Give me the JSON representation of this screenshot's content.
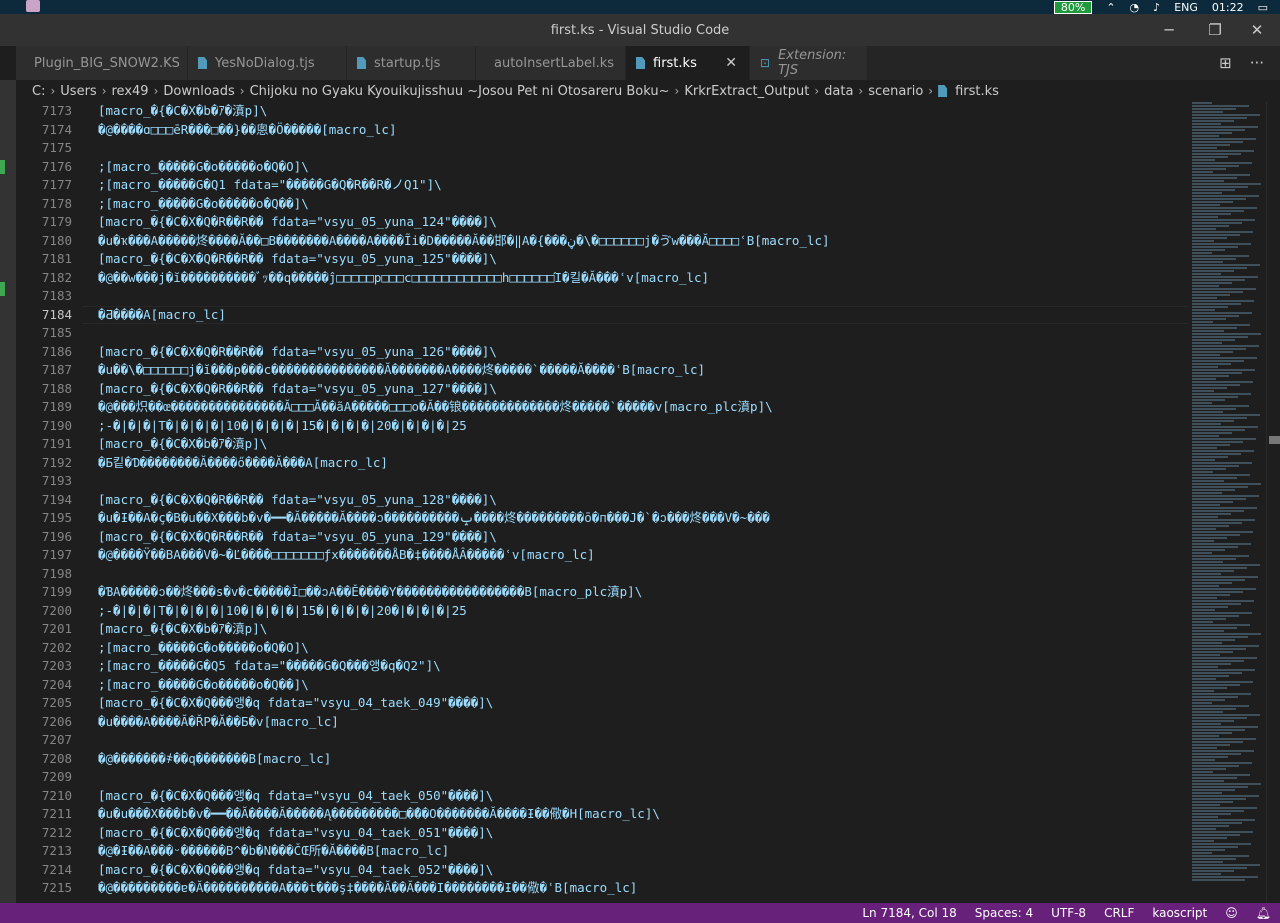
{
  "os": {
    "battery": "80%",
    "language": "ENG",
    "time": "01:22"
  },
  "window": {
    "title": "first.ks - Visual Studio Code",
    "minimize": "─",
    "restore": "❐",
    "close": "✕"
  },
  "tabs": [
    {
      "label": "Plugin_BIG_SNOW2.KS"
    },
    {
      "label": "YesNoDialog.tjs"
    },
    {
      "label": "startup.tjs"
    },
    {
      "label": "autoInsertLabel.ks"
    },
    {
      "label": "first.ks",
      "close": "✕"
    },
    {
      "label": "Extension: TJS"
    }
  ],
  "tab_actions": {
    "split": "⊞",
    "more": "···"
  },
  "breadcrumb": [
    "C:",
    "Users",
    "rex49",
    "Downloads",
    "Chijoku no Gyaku Kyouikujisshuu ~Josou Pet ni Otosareru Boku~",
    "KrkrExtract_Output",
    "data",
    "scenario",
    "first.ks"
  ],
  "editor": {
    "lines": [
      {
        "n": "7173",
        "t": "[macro_�{�C�X�b�ｱ�濆p]\\"
      },
      {
        "n": "7174",
        "t": "�@����ɑ□□□ēR���□��}��悤�Ö�����[macro_lc]"
      },
      {
        "n": "7175",
        "t": ""
      },
      {
        "n": "7176",
        "t": ";[macro_�����G�o�����o�Q�O]\\"
      },
      {
        "n": "7177",
        "t": ";[macro_�����G�Q1 fdata=\"�����G�Q�R��R�ノQ1\"]\\"
      },
      {
        "n": "7178",
        "t": ";[macro_�����G�o�����o�Q��]\\"
      },
      {
        "n": "7179",
        "t": "[macro_�{�C�X�Q�R��R�� fdata=\"vsyu_05_yuna_124\"����]\\"
      },
      {
        "n": "7180",
        "t": "�u�ҡ���A�����炵����Ă��□B�������A����A����Ĩi�D�����Ă��邯�‖A�{���ڼ�\\�□□□□□□j�ゔw���Ă□□□□ʿB[macro_lc]"
      },
      {
        "n": "7181",
        "t": "[macro_�{�C�X�Q�R��R�� fdata=\"vsyu_05_yuna_125\"����]\\"
      },
      {
        "n": "7182",
        "t": "�@��w���j�ĭ����������ﾞｯ��q�����ĵ□□□□□p□□□c□□□□□□□□□□□□h□□□□□□Ί�킬�Ă���ʿv[macro_lc]"
      },
      {
        "n": "7183",
        "t": ""
      },
      {
        "n": "7184",
        "t": "�Ƌ����A[macro_lc]"
      },
      {
        "n": "7185",
        "t": ""
      },
      {
        "n": "7186",
        "t": "[macro_�{�C�X�Q�R��R�� fdata=\"vsyu_05_yuna_126\"����]\\"
      },
      {
        "n": "7187",
        "t": "�u��\\�□□□□□□j�ĭ���p���c���������������Ă�������A����炵�����`�����Ă����ʿB[macro_lc]"
      },
      {
        "n": "7188",
        "t": "[macro_�{�C�X�Q�R��R�� fdata=\"vsyu_05_yuna_127\"����]\\"
      },
      {
        "n": "7189",
        "t": "�@���炽��œ���������������Ă□□□Ă��ãA�����□□□o�Ă��锒�������������炵�����`�����v[macro_plc濆p]\\"
      },
      {
        "n": "7190",
        "t": ";-�|�|�|T�|�|�|�|10�|�|�|�|15�|�|�|�|20�|�|�|�|25"
      },
      {
        "n": "7191",
        "t": "[macro_�{�C�X�b�ｱ�濆p]\\"
      },
      {
        "n": "7192",
        "t": "�Б킽�Ɗ��������Ă����ő����Ă���A[macro_lc]"
      },
      {
        "n": "7193",
        "t": ""
      },
      {
        "n": "7194",
        "t": "[macro_�{�C�X�Q�R��R�� fdata=\"vsyu_05_yuna_128\"����]\\"
      },
      {
        "n": "7195",
        "t": "�u�Ɨ��A�ç�B�u��X���b�v�━━�Ă�����Ă����ↄ����������ݒ����炵���������ō�п���J�`�ↄ���炵���V�~���"
      },
      {
        "n": "7196",
        "t": "[macro_�{�C�X�Q�R��R�� fdata=\"vsyu_05_yuna_129\"����]\\"
      },
      {
        "n": "7197",
        "t": "�@����Ÿ��BA���V�~�Ľ����□□□□□□□ƒx�������ÅB�‡����ÅÂ�����ʿv[macro_lc]"
      },
      {
        "n": "7198",
        "t": ""
      },
      {
        "n": "7199",
        "t": "�ƁA�����ↄ��炵���s�v�c�����Ì□��ↄA��Ě����Y����������́�������B[macro_plc濆p]\\"
      },
      {
        "n": "7200",
        "t": ";-�|�|�|T�|�|�|�|10�|�|�|�|15�|�|�|�|20�|�|�|�|25"
      },
      {
        "n": "7201",
        "t": "[macro_�{�C�X�b�ｱ�濆p]\\"
      },
      {
        "n": "7202",
        "t": ";[macro_�����G�o�����o�Q�O]\\"
      },
      {
        "n": "7203",
        "t": ";[macro_�����G�Q5 fdata=\"�����G�Q���앵�q�Q2\"]\\"
      },
      {
        "n": "7204",
        "t": ";[macro_�����G�o�����o�Q��]\\"
      },
      {
        "n": "7205",
        "t": "[macro_�{�C�X�Q���앵�q fdata=\"vsyu_04_taek_049\"����]\\"
      },
      {
        "n": "7206",
        "t": "�u����A����Ă�ŘP�Ă��Ƃ�v[macro_lc]"
      },
      {
        "n": "7207",
        "t": ""
      },
      {
        "n": "7208",
        "t": "�@�������҂��q�������B[macro_lc]"
      },
      {
        "n": "7209",
        "t": ""
      },
      {
        "n": "7210",
        "t": "[macro_�{�C�X�Q���앵�q fdata=\"vsyu_04_taek_050\"����]\\"
      },
      {
        "n": "7211",
        "t": "�u�u���X���b�v�━━��Ă����Ă�����Ą���������□�̃��O�������Ă����Ɨ��儆�H[macro_lc]\\"
      },
      {
        "n": "7212",
        "t": "[macro_�{�C�X�Q���앵�q fdata=\"vsyu_04_taek_051\"����]\\"
      },
      {
        "n": "7213",
        "t": "�@�Ɨ��A���ᵕ������B^�b�N���ČŒ所�Ă����B[macro_lc]"
      },
      {
        "n": "7214",
        "t": "[macro_�{�C�X�Q���앵�q fdata=\"vsyu_04_taek_052\"����]\\"
      },
      {
        "n": "7215",
        "t": "�@���������ɐ�Ă������̂����A���t���ş‡����Ă��Ă���I��������Ɨ��儆�ʿB[macro_lc]"
      }
    ]
  },
  "status": {
    "position": "Ln 7184, Col 18",
    "spaces": "Spaces: 4",
    "encoding": "UTF-8",
    "eol": "CRLF",
    "language": "kaoscript"
  }
}
